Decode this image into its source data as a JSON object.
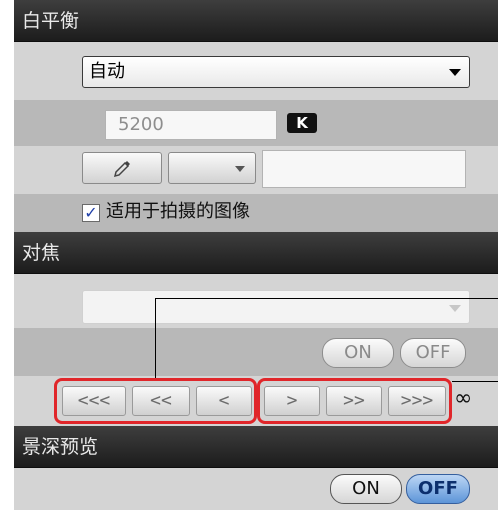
{
  "white_balance": {
    "title": "白平衡",
    "mode_value": "自动",
    "kelvin_value": "5200",
    "kelvin_badge": "K",
    "eyedropper_icon": "eyedropper-icon",
    "apply_checkbox_checked": true,
    "apply_label": "适用于拍摄的图像"
  },
  "focus": {
    "title": "对焦",
    "on_label": "ON",
    "off_label": "OFF",
    "nav_buttons": [
      "<<<",
      "<<",
      "<",
      ">",
      ">>",
      ">>>"
    ],
    "infinity_symbol": "∞"
  },
  "dof_preview": {
    "title": "景深预览",
    "on_label": "ON",
    "off_label": "OFF",
    "selected": "OFF"
  },
  "colors": {
    "header": "#2a2a2a",
    "panel": "#c6c6c6",
    "highlight": "#e0262a",
    "active_blue": "#5d95d8"
  }
}
